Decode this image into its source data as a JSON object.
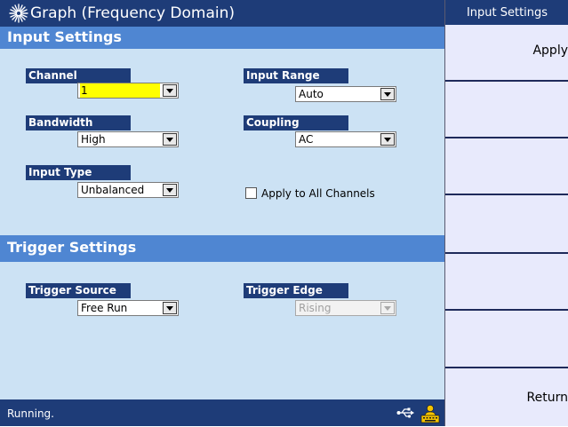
{
  "window": {
    "title": "Graph (Frequency Domain)",
    "logo_icon": "agilent-spark-icon"
  },
  "input_settings": {
    "heading": "Input Settings",
    "channel": {
      "label": "Channel",
      "value": "1"
    },
    "input_range": {
      "label": "Input Range",
      "value": "Auto"
    },
    "bandwidth": {
      "label": "Bandwidth",
      "value": "High"
    },
    "coupling": {
      "label": "Coupling",
      "value": "AC"
    },
    "input_type": {
      "label": "Input Type",
      "value": "Unbalanced"
    },
    "apply_all": {
      "label": "Apply to All Channels",
      "checked": false
    }
  },
  "trigger_settings": {
    "heading": "Trigger Settings",
    "trigger_source": {
      "label": "Trigger Source",
      "value": "Free Run"
    },
    "trigger_edge": {
      "label": "Trigger Edge",
      "value": "Rising",
      "disabled": true
    }
  },
  "status": {
    "text": "Running.",
    "icons": [
      "usb-icon",
      "keyboard-user-icon"
    ]
  },
  "softkeys": {
    "title": "Input Settings",
    "apply": "Apply",
    "return": "Return"
  },
  "colors": {
    "title_bar": "#1e3c78",
    "section_bar": "#4f86d2",
    "form_background": "#cce2f4",
    "selected_value_highlight": "#ffff00",
    "softkey_panel": "#e8eafc"
  }
}
